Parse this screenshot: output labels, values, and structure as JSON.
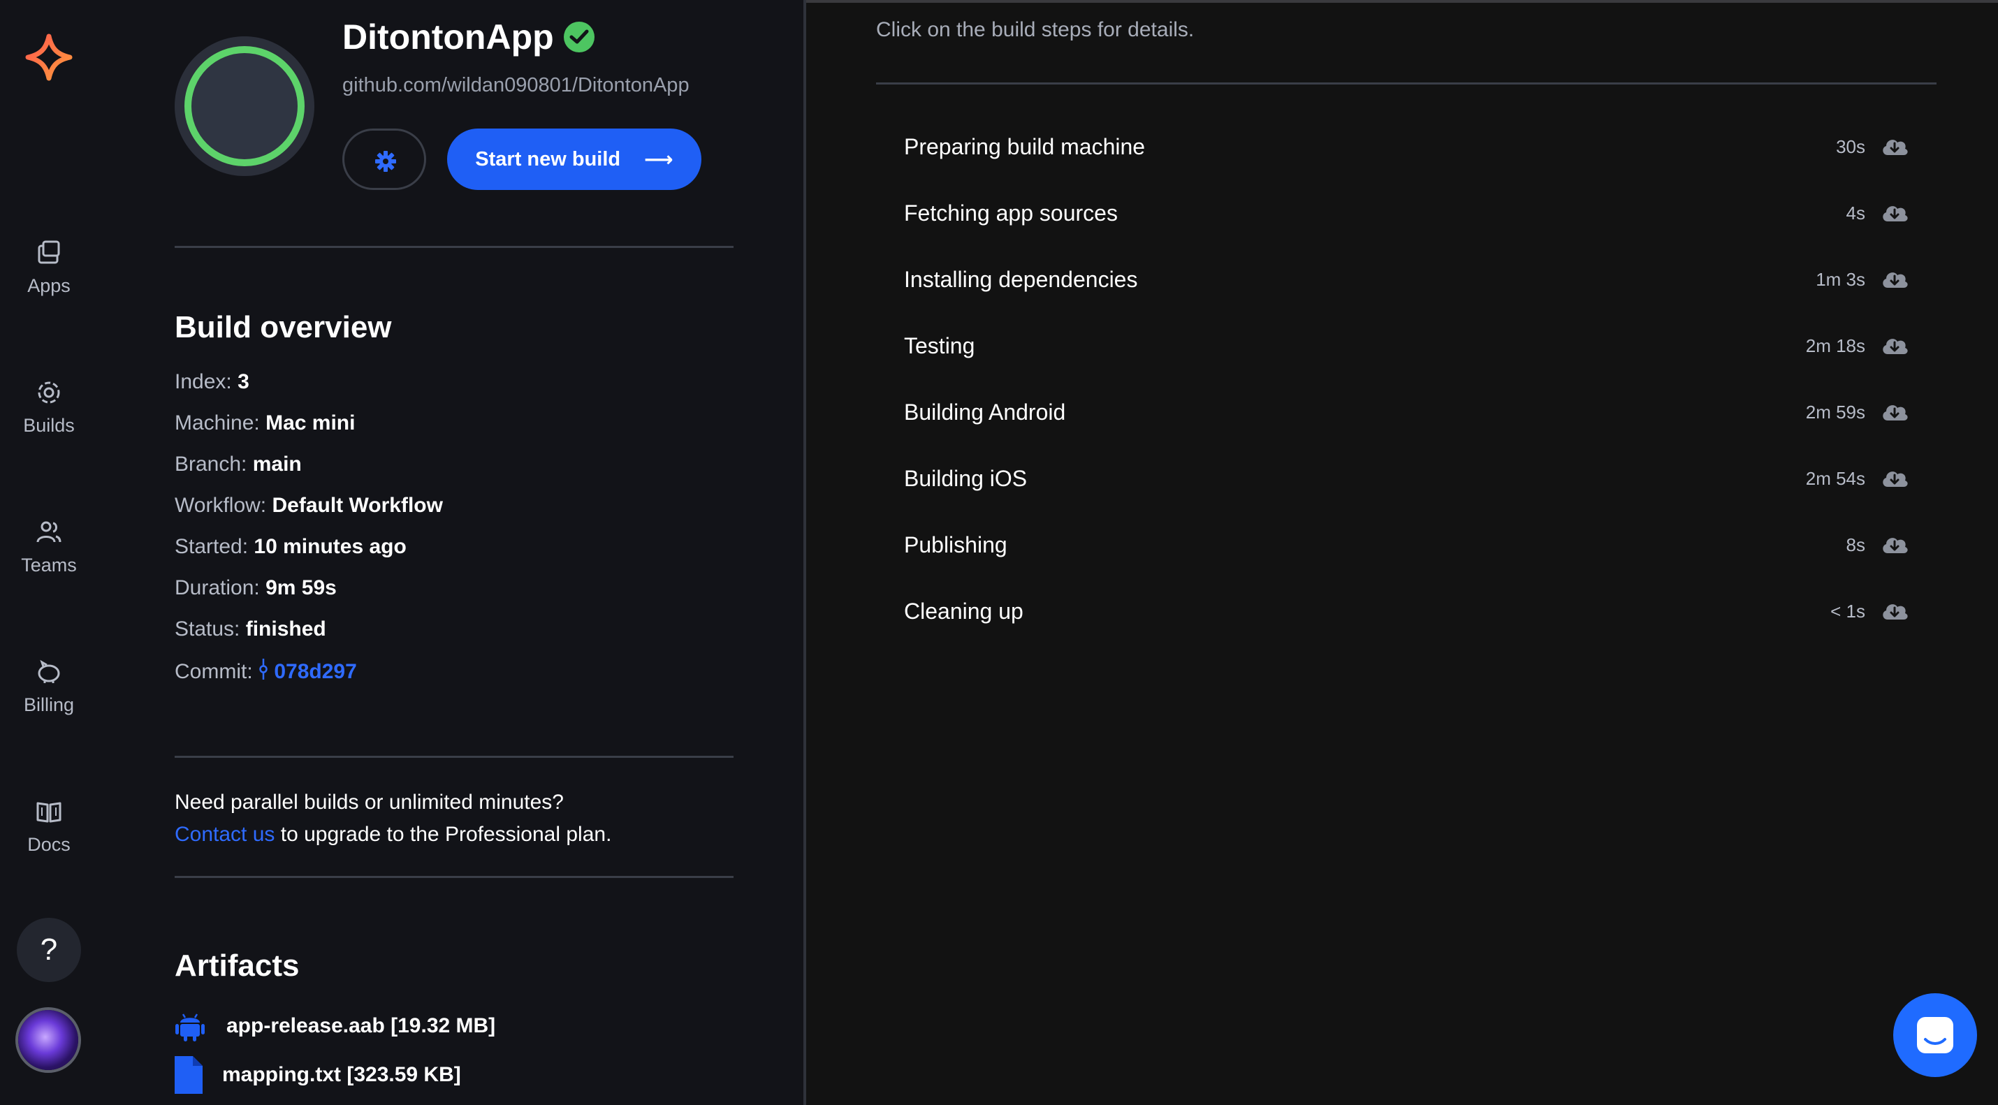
{
  "nav": {
    "items": [
      {
        "label": "Apps",
        "icon": "apps-icon"
      },
      {
        "label": "Builds",
        "icon": "builds-icon"
      },
      {
        "label": "Teams",
        "icon": "teams-icon"
      },
      {
        "label": "Billing",
        "icon": "billing-icon"
      },
      {
        "label": "Docs",
        "icon": "docs-icon"
      }
    ],
    "help_label": "?"
  },
  "app": {
    "name": "DitontonApp",
    "repo": "github.com/wildan090801/DitontonApp",
    "start_build_label": "Start new build",
    "arrow": "⟶"
  },
  "overview": {
    "title": "Build overview",
    "fields": [
      {
        "key": "Index:",
        "value": "3"
      },
      {
        "key": "Machine:",
        "value": "Mac mini"
      },
      {
        "key": "Branch:",
        "value": "main"
      },
      {
        "key": "Workflow:",
        "value": "Default Workflow"
      },
      {
        "key": "Started:",
        "value": "10 minutes ago"
      },
      {
        "key": "Duration:",
        "value": "9m 59s"
      },
      {
        "key": "Status:",
        "value": "finished"
      }
    ],
    "commit_key": "Commit:",
    "commit_value": "078d297"
  },
  "promo": {
    "line1": "Need parallel builds or unlimited minutes?",
    "link": "Contact us",
    "line2_rest": " to upgrade to the Professional plan."
  },
  "artifacts": {
    "title": "Artifacts",
    "items": [
      {
        "name": "app-release.aab [19.32 MB]",
        "icon": "android-icon"
      },
      {
        "name": "mapping.txt [323.59 KB]",
        "icon": "file-icon"
      }
    ]
  },
  "steps": {
    "hint": "Click on the build steps for details.",
    "items": [
      {
        "label": "Preparing build machine",
        "duration": "30s"
      },
      {
        "label": "Fetching app sources",
        "duration": "4s"
      },
      {
        "label": "Installing dependencies",
        "duration": "1m 3s"
      },
      {
        "label": "Testing",
        "duration": "2m 18s"
      },
      {
        "label": "Building Android",
        "duration": "2m 59s"
      },
      {
        "label": "Building iOS",
        "duration": "2m 54s"
      },
      {
        "label": "Publishing",
        "duration": "8s"
      },
      {
        "label": "Cleaning up",
        "duration": "< 1s"
      }
    ]
  },
  "colors": {
    "accent": "#1f5ff5",
    "success": "#4dc561",
    "background": "#121212",
    "panel": "#121318"
  }
}
